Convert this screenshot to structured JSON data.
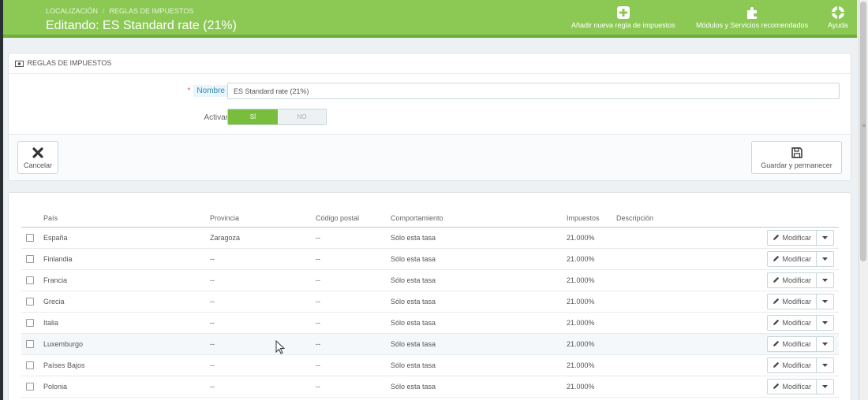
{
  "header": {
    "breadcrumb": [
      "LOCALIZACIÓN",
      "REGLAS DE IMPUESTOS"
    ],
    "breadcrumb_sep": "/",
    "title": "Editando: ES Standard rate (21%)",
    "toolbar": {
      "add_rule": {
        "label": "Añadir nueva regla de impuestos",
        "icon": "plus-square-icon"
      },
      "modules": {
        "label": "Módulos y Servicios recomendados",
        "icon": "puzzle-icon"
      },
      "help": {
        "label": "Ayuda",
        "icon": "lifebuoy-icon"
      }
    },
    "colors": {
      "bg": "#8bc954",
      "border": "#6fae3a"
    }
  },
  "form": {
    "heading": "REGLAS DE IMPUESTOS",
    "name_required_mark": "*",
    "name_label": "Nombre",
    "name_value": "ES Standard rate (21%)",
    "active_label": "Activar",
    "toggle_yes": "SÍ",
    "toggle_no": "NO",
    "toggle_selected": "SÍ",
    "cancel_label": "Cancelar",
    "save_stay_label": "Guardar y permanecer"
  },
  "table": {
    "columns": [
      "País",
      "Provincia",
      "Código postal",
      "Comportamiento",
      "Impuestos",
      "Descripción"
    ],
    "modify_label": "Modificar",
    "rows": [
      {
        "country": "España",
        "province": "Zaragoza",
        "zip": "--",
        "behavior": "Sólo esta tasa",
        "tax": "21.000%",
        "description": ""
      },
      {
        "country": "Finlandia",
        "province": "--",
        "zip": "--",
        "behavior": "Sólo esta tasa",
        "tax": "21.000%",
        "description": ""
      },
      {
        "country": "Francia",
        "province": "--",
        "zip": "--",
        "behavior": "Sólo esta tasa",
        "tax": "21.000%",
        "description": ""
      },
      {
        "country": "Grecia",
        "province": "--",
        "zip": "--",
        "behavior": "Sólo esta tasa",
        "tax": "21.000%",
        "description": ""
      },
      {
        "country": "Italia",
        "province": "--",
        "zip": "--",
        "behavior": "Sólo esta tasa",
        "tax": "21.000%",
        "description": ""
      },
      {
        "country": "Luxemburgo",
        "province": "--",
        "zip": "--",
        "behavior": "Sólo esta tasa",
        "tax": "21.000%",
        "description": ""
      },
      {
        "country": "Países Bajos",
        "province": "--",
        "zip": "--",
        "behavior": "Sólo esta tasa",
        "tax": "21.000%",
        "description": ""
      },
      {
        "country": "Polonia",
        "province": "--",
        "zip": "--",
        "behavior": "Sólo esta tasa",
        "tax": "21.000%",
        "description": ""
      }
    ]
  }
}
